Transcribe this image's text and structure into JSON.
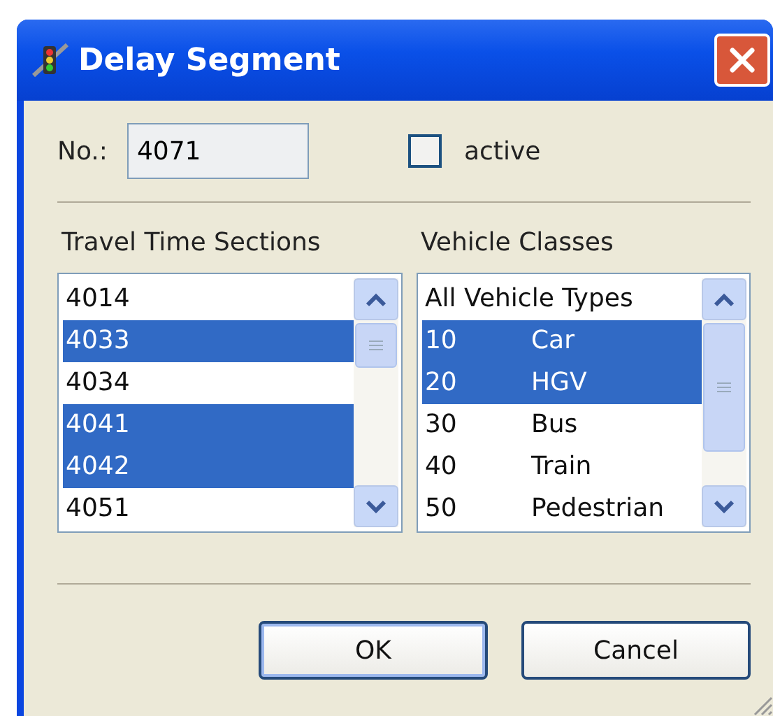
{
  "window": {
    "title": "Delay Segment"
  },
  "number": {
    "label": "No.:",
    "value": "4071"
  },
  "active": {
    "label": "active",
    "checked": false
  },
  "travel_time_sections": {
    "label": "Travel Time Sections",
    "items": [
      {
        "text": "4014",
        "selected": false
      },
      {
        "text": "4033",
        "selected": true
      },
      {
        "text": "4034",
        "selected": false
      },
      {
        "text": "4041",
        "selected": true
      },
      {
        "text": "4042",
        "selected": true
      },
      {
        "text": "4051",
        "selected": false
      }
    ]
  },
  "vehicle_classes": {
    "label": "Vehicle Classes",
    "items": [
      {
        "kind": "all",
        "name": "All Vehicle Types",
        "selected": false
      },
      {
        "kind": "class",
        "code": "10",
        "name": "Car",
        "selected": true
      },
      {
        "kind": "class",
        "code": "20",
        "name": "HGV",
        "selected": true
      },
      {
        "kind": "class",
        "code": "30",
        "name": "Bus",
        "selected": false
      },
      {
        "kind": "class",
        "code": "40",
        "name": "Train",
        "selected": false
      },
      {
        "kind": "class",
        "code": "50",
        "name": "Pedestrian",
        "selected": false
      }
    ]
  },
  "buttons": [
    "OK",
    "Cancel"
  ]
}
